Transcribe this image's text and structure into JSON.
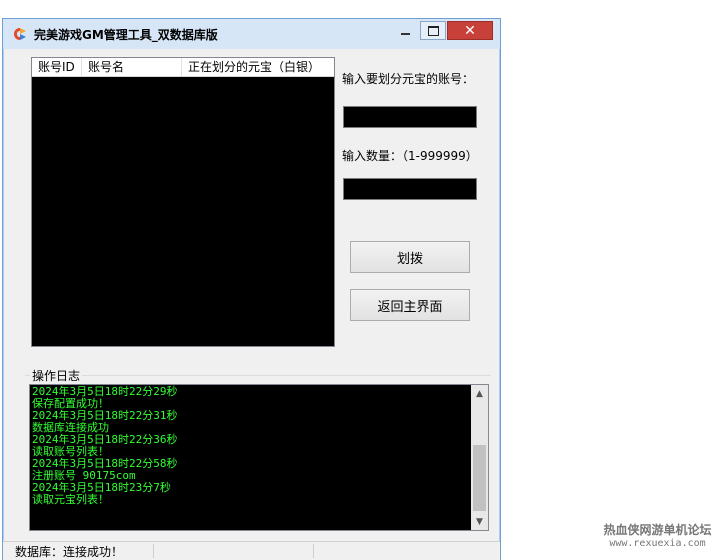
{
  "window": {
    "title": "完美游戏GM管理工具_双数据库版",
    "close_glyph": "✕"
  },
  "accounts_list": {
    "columns": [
      "账号ID",
      "账号名",
      "正在划分的元宝（白银）"
    ],
    "rows": []
  },
  "form": {
    "account_label": "输入要划分元宝的账号：",
    "account_value": "",
    "amount_label": "输入数量：（1-999999）",
    "amount_value": ""
  },
  "buttons": {
    "allocate": "划拨",
    "back": "返回主界面"
  },
  "log": {
    "group_label": "操作日志",
    "lines": [
      "2024年3月5日18时22分29秒",
      "保存配置成功！",
      "2024年3月5日18时22分31秒",
      "数据库连接成功",
      "2024年3月5日18时22分36秒",
      "读取账号列表！",
      "2024年3月5日18时22分58秒",
      "注册账号  90175com",
      "2024年3月5日18时23分7秒",
      "读取元宝列表！"
    ]
  },
  "status": {
    "text": "数据库：连接成功！"
  },
  "watermark": {
    "main": "热血侠网游单机论坛",
    "url": "www.rexuexia.com"
  },
  "colors": {
    "log_text": "#33ff33",
    "close_button": "#c7403a",
    "titlebar": "#d6e6f7"
  }
}
